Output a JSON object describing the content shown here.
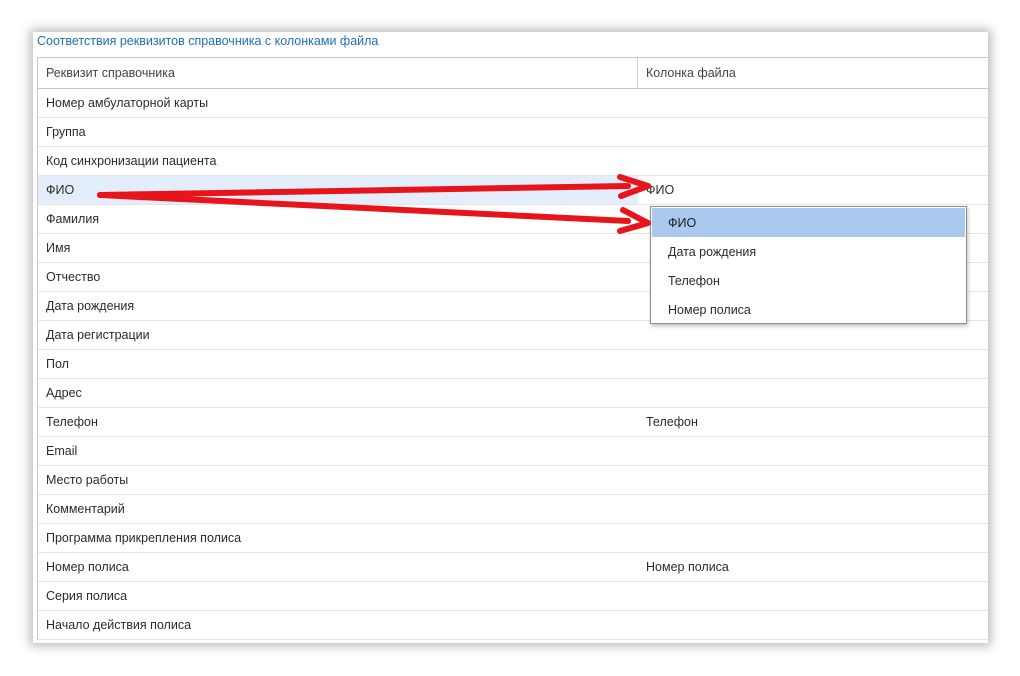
{
  "panel": {
    "title": "Соответствия реквизитов справочника с колонками файла"
  },
  "table": {
    "headers": [
      "Реквизит справочника",
      "Колонка файла"
    ],
    "rows": [
      {
        "attr": "Номер амбулаторной карты",
        "column": ""
      },
      {
        "attr": "Группа",
        "column": ""
      },
      {
        "attr": "Код синхронизации пациента",
        "column": ""
      },
      {
        "attr": "ФИО",
        "column": "ФИО"
      },
      {
        "attr": "Фамилия",
        "column": ""
      },
      {
        "attr": "Имя",
        "column": ""
      },
      {
        "attr": "Отчество",
        "column": ""
      },
      {
        "attr": "Дата рождения",
        "column": ""
      },
      {
        "attr": "Дата регистрации",
        "column": ""
      },
      {
        "attr": "Пол",
        "column": ""
      },
      {
        "attr": "Адрес",
        "column": ""
      },
      {
        "attr": "Телефон",
        "column": "Телефон"
      },
      {
        "attr": "Email",
        "column": ""
      },
      {
        "attr": "Место работы",
        "column": ""
      },
      {
        "attr": "Комментарий",
        "column": ""
      },
      {
        "attr": "Программа прикрепления полиса",
        "column": ""
      },
      {
        "attr": "Номер полиса",
        "column": "Номер полиса"
      },
      {
        "attr": "Серия полиса",
        "column": ""
      },
      {
        "attr": "Начало действия полиса",
        "column": ""
      }
    ],
    "selected_row": 3
  },
  "dropdown": {
    "options": [
      "ФИО",
      "Дата рождения",
      "Телефон",
      "Номер полиса"
    ],
    "highlighted": 0
  },
  "colors": {
    "title": "#1f6fb5",
    "selected_row": "#e3eefa",
    "dropdown_highlight": "#a9c9ef",
    "arrow": "#e8141c"
  },
  "annotations": {
    "arrow_icon": "red-arrow-icon"
  }
}
